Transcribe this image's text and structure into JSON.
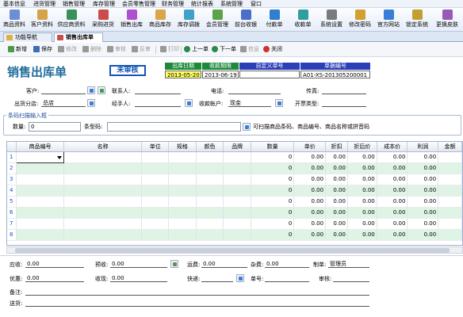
{
  "menu": [
    "基本信息",
    "进货管理",
    "销售管理",
    "库存管理",
    "会员零售管理",
    "财务管理",
    "统计报表",
    "系统管理",
    "窗口"
  ],
  "toolbar": [
    {
      "label": "商品资料",
      "color": "#6b8fd6"
    },
    {
      "label": "客户资料",
      "color": "#d5a34a"
    },
    {
      "label": "供应商资料",
      "color": "#3c8f5a"
    },
    {
      "label": "采购进货",
      "color": "#c94d4d"
    },
    {
      "label": "销售出库",
      "color": "#b04fd0"
    },
    {
      "label": "商品库存",
      "color": "#d9a64a"
    },
    {
      "label": "库存调拨",
      "color": "#3fa0c9"
    },
    {
      "label": "会员管理",
      "color": "#5aa34a"
    },
    {
      "label": "前台收银",
      "color": "#4a6fc9"
    },
    {
      "label": "付款单",
      "color": "#2f7fce"
    },
    {
      "label": "收款单",
      "color": "#2e9e9e"
    },
    {
      "label": "系统设置",
      "color": "#7a7a7a"
    },
    {
      "label": "修改密码",
      "color": "#d0a030"
    },
    {
      "label": "官方网站",
      "color": "#3a7ed8"
    },
    {
      "label": "锁定系统",
      "color": "#c0a030"
    },
    {
      "label": "更换皮肤",
      "color": "#9b59b6"
    }
  ],
  "tabs": [
    {
      "label": "功能导航"
    },
    {
      "label": "销售出库单"
    }
  ],
  "actions": [
    {
      "label": "新增",
      "color": "#4a9a4a",
      "disabled": false
    },
    {
      "label": "保存",
      "color": "#3c6fb8",
      "disabled": false
    },
    {
      "label": "修改",
      "color": "#999",
      "disabled": true
    },
    {
      "label": "删除",
      "color": "#999",
      "disabled": true
    },
    {
      "label": "审核",
      "color": "#999",
      "disabled": true
    },
    {
      "label": "反审",
      "color": "#999",
      "disabled": true
    },
    {
      "label": "打印",
      "color": "#999",
      "disabled": true
    },
    {
      "label": "上一单",
      "color": "#2a8a4a",
      "disabled": false
    },
    {
      "label": "下一单",
      "color": "#2a8a4a",
      "disabled": false
    },
    {
      "label": "信息",
      "color": "#999",
      "disabled": true
    },
    {
      "label": "关闭",
      "color": "#d03030",
      "disabled": false
    }
  ],
  "form": {
    "title": "销售出库单",
    "status": "未审核",
    "date_headers": [
      "出库日期",
      "收款期限",
      "自定义单号",
      "单据编号"
    ],
    "date_header_colors": [
      "#1c8a3a",
      "#1c8a3a",
      "#2b3fb8",
      "#2b3fb8"
    ],
    "date_values": [
      "2013-05-20",
      "2013-06-19",
      "",
      "A01-XS-201305200001"
    ],
    "customer_label": "客户:",
    "contact_label": "联系人:",
    "phone_label": "电话:",
    "fax_label": "传真:",
    "branch_label": "出货分店:",
    "branch_value": "总店",
    "handler_label": "经手人:",
    "account_label": "收款帐户:",
    "account_value": "现金",
    "invoice_label": "开票类型:"
  },
  "scan": {
    "title": "条码扫描输入框",
    "qty_label": "数量:",
    "qty_value": "0",
    "barcode_label": "条型码:",
    "hint": "可扫描商品条码、商品编号、商品名称或拼音码"
  },
  "grid": {
    "columns": [
      "",
      "商品编号",
      "名称",
      "单位",
      "规格",
      "颜色",
      "品牌",
      "数量",
      "单价",
      "折扣",
      "折后价",
      "成本价",
      "利润",
      "金额"
    ],
    "rows": [
      {
        "no": "1",
        "qty": "0",
        "price": "0.00",
        "discount": "0.00",
        "net": "0.00",
        "cost": "0.00",
        "profit": "0.00"
      },
      {
        "no": "2",
        "qty": "0",
        "price": "0.00",
        "discount": "0.00",
        "net": "0.00",
        "cost": "0.00",
        "profit": "0.00"
      },
      {
        "no": "3",
        "qty": "0",
        "price": "0.00",
        "discount": "0.00",
        "net": "0.00",
        "cost": "0.00",
        "profit": "0.00"
      },
      {
        "no": "4",
        "qty": "0",
        "price": "0.00",
        "discount": "0.00",
        "net": "0.00",
        "cost": "0.00",
        "profit": "0.00"
      },
      {
        "no": "5",
        "qty": "0",
        "price": "0.00",
        "discount": "0.00",
        "net": "0.00",
        "cost": "0.00",
        "profit": "0.00"
      },
      {
        "no": "6",
        "qty": "0",
        "price": "0.00",
        "discount": "0.00",
        "net": "0.00",
        "cost": "0.00",
        "profit": "0.00"
      },
      {
        "no": "7",
        "qty": "0",
        "price": "0.00",
        "discount": "0.00",
        "net": "0.00",
        "cost": "0.00",
        "profit": "0.00"
      },
      {
        "no": "8",
        "qty": "0",
        "price": "0.00",
        "discount": "0.00",
        "net": "0.00",
        "cost": "0.00",
        "profit": "0.00"
      }
    ]
  },
  "footer": {
    "receivable_label": "应收:",
    "receivable_value": "0.00",
    "prepaid_label": "预收:",
    "prepaid_value": "0.00",
    "freight_label": "运费:",
    "freight_value": "0.00",
    "misc_label": "杂费:",
    "misc_value": "0.00",
    "maker_label": "制单:",
    "maker_value": "管理员",
    "discount_label": "优惠:",
    "discount_value": "0.00",
    "received_label": "收现:",
    "received_value": "0.00",
    "express_label": "快递:",
    "waybill_label": "单号:",
    "auditor_label": "审核:",
    "remark_label": "备注:",
    "delivery_label": "送货:"
  }
}
